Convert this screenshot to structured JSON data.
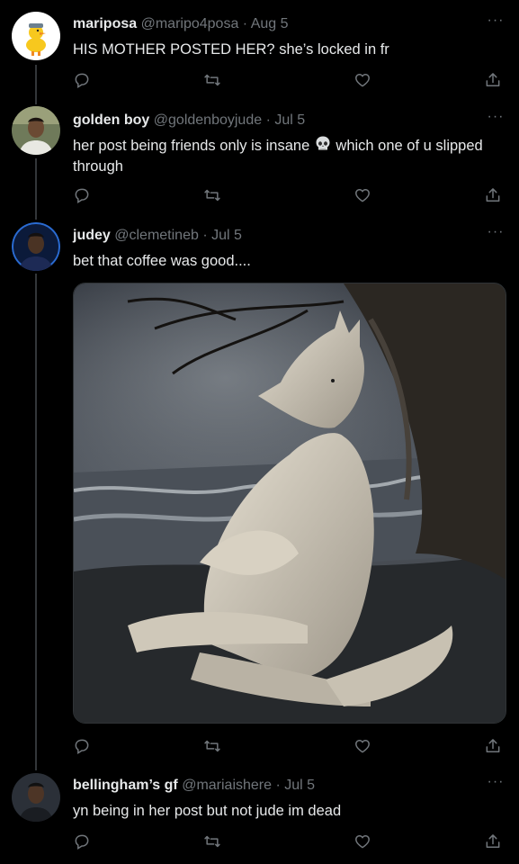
{
  "tweets": [
    {
      "name": "mariposa",
      "handle": "@maripo4posa",
      "separator": "·",
      "date": "Aug 5",
      "text": "HIS MOTHER POSTED HER? she’s locked in fr",
      "more": "···"
    },
    {
      "name": "golden boy",
      "handle": "@goldenboyjude",
      "separator": "·",
      "date": "Jul 5",
      "text_before_emoji": "her post being friends only is insane ",
      "emoji": "skull",
      "text_after_emoji": " which one of u slipped through",
      "more": "···"
    },
    {
      "name": "judey",
      "handle": "@clemetineb",
      "separator": "·",
      "date": "Jul 5",
      "text": "bet that coffee was good....",
      "more": "···",
      "media": "illustration of a white wolf sitting under a tree by a stormy sea"
    },
    {
      "name": "bellingham’s gf",
      "handle": "@mariaishere",
      "separator": "·",
      "date": "Jul 5",
      "text": "yn being in her post but not jude im dead",
      "more": "···"
    }
  ],
  "icons": {
    "reply": "reply-icon",
    "retweet": "retweet-icon",
    "like": "like-icon",
    "share": "share-icon"
  },
  "colors": {
    "background": "#000000",
    "text": "#e7e9ea",
    "secondary": "#71767b",
    "thread_line": "#333639"
  }
}
